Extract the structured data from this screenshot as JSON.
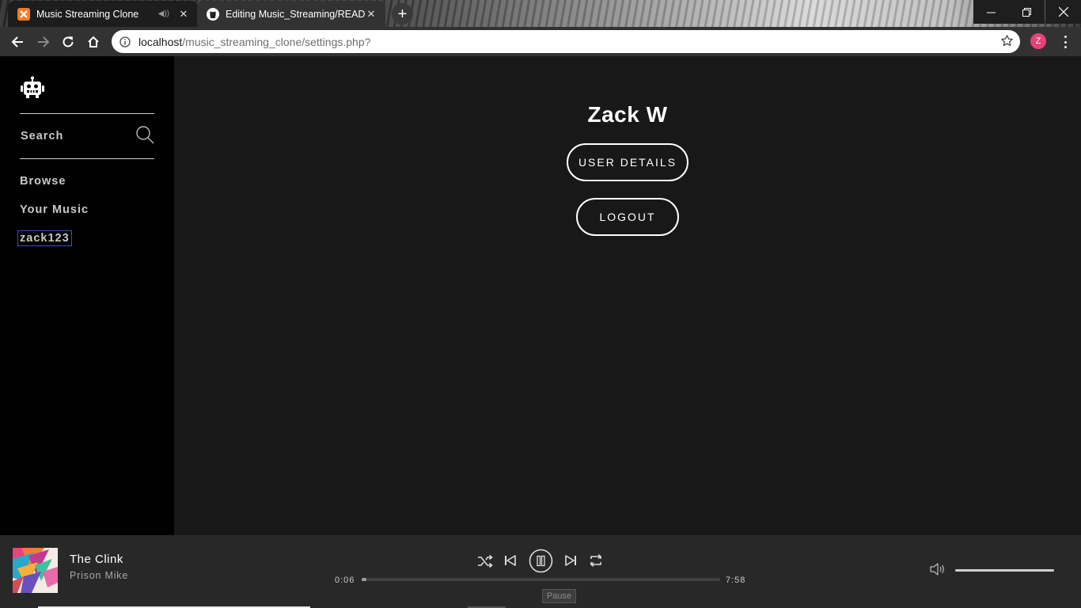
{
  "browser": {
    "tabs": [
      {
        "title": "Music Streaming Clone",
        "active": false,
        "favicon": "xampp-icon"
      },
      {
        "title": "Editing Music_Streaming/READM",
        "active": true,
        "favicon": "github-icon"
      }
    ],
    "url_host": "localhost",
    "url_path": "/music_streaming_clone/settings.php?",
    "profile_initial": "Z",
    "profile_color": "#e8407a"
  },
  "sidebar": {
    "search_label": "Search",
    "items": [
      {
        "label": "Browse"
      },
      {
        "label": "Your Music"
      },
      {
        "label": "zack123"
      }
    ]
  },
  "settings": {
    "name": "Zack W",
    "user_details_label": "USER DETAILS",
    "logout_label": "LOGOUT"
  },
  "player": {
    "track": "The Clink",
    "artist": "Prison Mike",
    "current_time": "0:06",
    "duration": "7:58",
    "progress_fraction": 0.0126,
    "volume_fraction": 1.0,
    "tooltip": "Pause"
  }
}
